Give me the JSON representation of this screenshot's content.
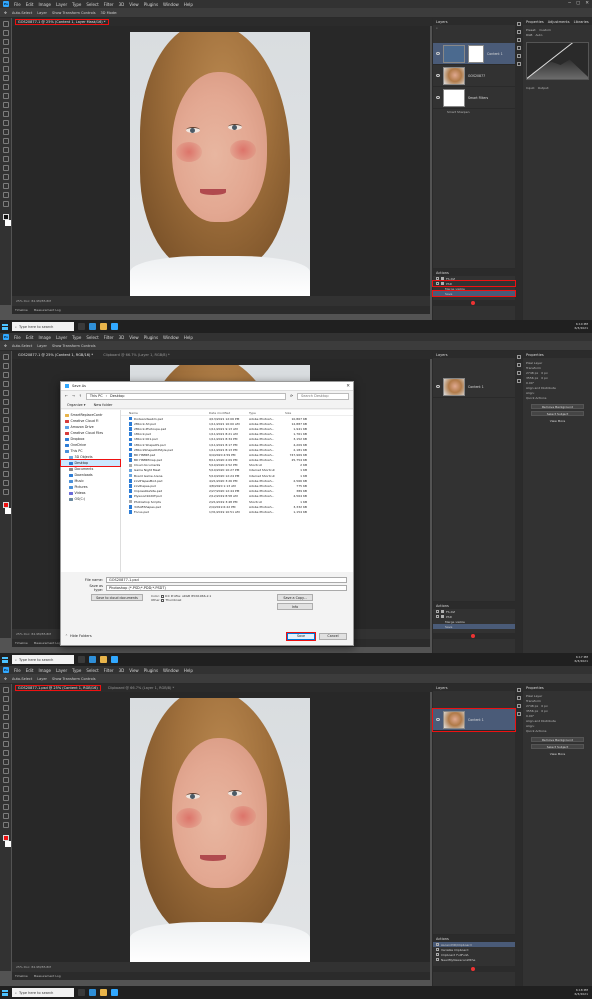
{
  "menu": [
    "File",
    "Edit",
    "Image",
    "Layer",
    "Type",
    "Select",
    "Filter",
    "3D",
    "View",
    "Plugins",
    "Window",
    "Help"
  ],
  "options": {
    "auto_select": "Auto-Select",
    "layer": "Layer",
    "transform_controls": "Show Transform Controls",
    "mode_3d": "3D Mode:"
  },
  "shot1": {
    "tab": "GOS20877-1 @ 25% (Content 1, Layer Mask/16) *",
    "status": "25%   Doc: 84.9M/85.8M",
    "layers_title": "Layers",
    "layers": [
      {
        "name": "Content 1"
      },
      {
        "name": "GOS20877"
      },
      {
        "name": "Smart Filters"
      },
      {
        "name": "Smart Sharpen"
      }
    ],
    "actions_title": "Actions",
    "actions": [
      "FS-DZ",
      "PSD",
      "Merge visible",
      "Save"
    ],
    "props_title": "Properties",
    "props_tabs": [
      "Adjustments",
      "Libraries",
      "Shapes"
    ],
    "preset_label": "Preset:",
    "preset_value": "Custom",
    "channel_value": "RGB",
    "auto_btn": "Auto",
    "input_label": "Input:",
    "output_label": "Output:"
  },
  "shot2": {
    "tab_active": "GOS20877-1 @ 25% (Content 1, RGB/16) *",
    "tab_other": "Clipboard @ 66.7% (Layer 1, RGB/8) *",
    "layers": [
      {
        "name": "Content 1"
      }
    ],
    "props_title": "Properties",
    "props_sub": "Pixel Layer",
    "transform": "Transform",
    "w_val": "2748 px",
    "h_val": "3556 px",
    "x_val": "0 px",
    "y_val": "0 px",
    "rot_val": "0.00°",
    "align": "Align and Distribute",
    "align_sub": "Align:",
    "quick_actions": "Quick Actions",
    "remove_bg": "Remove Background",
    "select_subject": "Select Subject",
    "more": "View More",
    "dialog": {
      "title": "Save As",
      "path": [
        "This PC",
        "Desktop"
      ],
      "search": "Search Desktop",
      "organize": "Organize ▾",
      "new_folder": "New folder",
      "nav": [
        {
          "label": "SmartReplaceContr",
          "color": "#e8b44a"
        },
        {
          "label": "Creative Cloud Fi",
          "color": "#d63a3a"
        },
        {
          "label": "Amazon Drive",
          "color": "#5aa0e6"
        },
        {
          "label": "Creative Cloud Files",
          "color": "#d63a3a"
        },
        {
          "label": "Dropbox",
          "color": "#2c7cd6"
        },
        {
          "label": "OneDrive",
          "color": "#2c7cd6"
        },
        {
          "label": "This PC",
          "color": "#4a90d9"
        },
        {
          "label": "3D Objects",
          "color": "#6aa6e0"
        },
        {
          "label": "Desktop",
          "color": "#2c7cd6"
        },
        {
          "label": "Documents",
          "color": "#8a8a8a"
        },
        {
          "label": "Downloads",
          "color": "#2c7cd6"
        },
        {
          "label": "Music",
          "color": "#4a90d9"
        },
        {
          "label": "Pictures",
          "color": "#4a90d9"
        },
        {
          "label": "Videos",
          "color": "#6a6ad9"
        },
        {
          "label": "OS(C:)",
          "color": "#6a8aa0"
        }
      ],
      "columns": [
        "Name",
        "Date modified",
        "Type",
        "Size"
      ],
      "files": [
        {
          "name": "Dodeandwebm.psd",
          "date": "4/13/2021 12:06 PM",
          "type": "Adobe Photosh...",
          "size": "10,867 KB"
        },
        {
          "name": "2Mlock-3d.psd",
          "date": "1/11/2021 10:00 AM",
          "type": "Adobe Photosh...",
          "size": "12,887 KB"
        },
        {
          "name": "2Mlock-Photoupe.psd",
          "date": "1/11/2021 9:13 AM",
          "type": "Adobe Photosh...",
          "size": "1,941 KB"
        },
        {
          "name": "1Mlock.psd",
          "date": "1/11/2021 8:21 AM",
          "type": "Adobe Photosh...",
          "size": "1,761 KB"
        },
        {
          "name": "1Mlock 001.psd",
          "date": "1/11/2021 8:34 PM",
          "type": "Adobe Photosh...",
          "size": "3,152 KB"
        },
        {
          "name": "1Mlock ShapeOS.psd",
          "date": "1/11/2021 8:17 PM",
          "type": "Adobe Photosh...",
          "size": "4,209 KB"
        },
        {
          "name": "2MlockShapeOldStyle.psd",
          "date": "1/11/2021 8:13 PM",
          "type": "Adobe Photosh...",
          "size": "2,181 KB"
        },
        {
          "name": "BD HNMM.psd",
          "date": "9/4/2020 4:59 PM",
          "type": "Adobe Photosh...",
          "size": "747,969 KB"
        },
        {
          "name": "BD HNMMmap.psd",
          "date": "8/11/2020 2:09 PM",
          "type": "Adobe Photosh...",
          "size": "25,754 KB"
        },
        {
          "name": "Cloud documents",
          "date": "5/10/2020 2:52 PM",
          "type": "Shortcut",
          "size": "2 KB"
        },
        {
          "name": "Game Night Meat",
          "date": "5/10/2020 10:27 PM",
          "type": "Internet Shortcut",
          "size": "1 KB"
        },
        {
          "name": "Board Game Arena",
          "date": "5/10/2020 12:24 PM",
          "type": "Internet Shortcut",
          "size": "1 KB"
        },
        {
          "name": "kindHapesMod.psd",
          "date": "4/21/2020 3:26 PM",
          "type": "Adobe Photosh...",
          "size": "2,566 KB"
        },
        {
          "name": "kindhapes.psd",
          "date": "4/8/2020 1:13 AM",
          "type": "Adobe Photosh...",
          "size": "775 KB"
        },
        {
          "name": "ImpossibleSite.psd",
          "date": "2/27/2020 12:44 PM",
          "type": "Adobe Photosh...",
          "size": "389 KB"
        },
        {
          "name": "Plywood1020F.psd",
          "date": "2/12/2019 8:58 AM",
          "type": "Adobe Photosh...",
          "size": "4,564 KB"
        },
        {
          "name": "Photoshop Scripts",
          "date": "2/21/2019 3:48 PM",
          "type": "Shortcut",
          "size": "1 KB"
        },
        {
          "name": "3dSoftShapes.psd",
          "date": "2/4/2019 6:22 PM",
          "type": "Adobe Photosh...",
          "size": "3,332 KB"
        },
        {
          "name": "Focus.psd",
          "date": "1/31/2019 10:51 AM",
          "type": "Adobe Photosh...",
          "size": "1,154 KB"
        }
      ],
      "file_name_label": "File name:",
      "file_name": "GOS20877-1.psd",
      "save_type_label": "Save as type:",
      "save_type": "Photoshop (*.PSD;*.PDD;*.PSDT)",
      "cloud_btn": "Save to cloud documents",
      "color_label": "Color:",
      "icc": "ICC Profile: sRGB IEC61966-2.1",
      "other_label": "Other:",
      "thumbnail": "Thumbnail",
      "save_copy": "Save a Copy...",
      "info": "Info",
      "hide_folders": "Hide Folders",
      "save": "Save",
      "cancel": "Cancel"
    }
  },
  "shot3": {
    "tab_active": "GOS20877-1.psd @ 25% (Content 1, RGB/16)",
    "tab_other": "Clipboard @ 66.7% (Layer 1, RGB/8) *",
    "layers": [
      {
        "name": "Content 1"
      }
    ],
    "actions": [
      "Ascend3D/Clipboard",
      "Variable Clipboard",
      "Clipboard FullFullA",
      "NeedMyNewscanWithe"
    ]
  },
  "taskbar": {
    "search": "Type here to search",
    "time1": "6:10 PM",
    "date1": "6/3/2021",
    "time2": "6:17 PM",
    "date2": "6/3/2021",
    "time3": "6:18 PM",
    "date3": "6/3/2021"
  },
  "timeline_tabs": [
    "Timeline",
    "Measurement Log"
  ],
  "colors": {
    "accent_red": "#e11111",
    "selected_blue": "#4a5b78",
    "ps_blue": "#31a8ff"
  }
}
